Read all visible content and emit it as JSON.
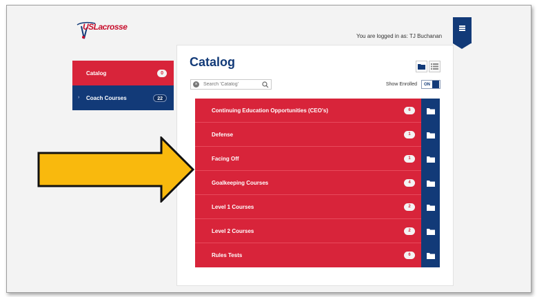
{
  "header": {
    "logo_text": "USLacrosse",
    "logged_in_text": "You are logged in as: TJ Buchanan"
  },
  "sidebar": {
    "items": [
      {
        "label": "Catalog",
        "count": "0"
      },
      {
        "label": "Coach Courses",
        "count": "22"
      }
    ]
  },
  "catalog": {
    "title": "Catalog",
    "search_placeholder": "Search 'Catalog'",
    "show_enrolled_label": "Show Enrolled",
    "toggle_label": "ON",
    "rows": [
      {
        "label": "Continuing Education Opportunities (CEO's)",
        "count": "6"
      },
      {
        "label": "Defense",
        "count": "1"
      },
      {
        "label": "Facing Off",
        "count": "1"
      },
      {
        "label": "Goalkeeping Courses",
        "count": "4"
      },
      {
        "label": "Level 1 Courses",
        "count": "2"
      },
      {
        "label": "Level 2 Courses",
        "count": "2"
      },
      {
        "label": "Rules Tests",
        "count": "6"
      }
    ]
  },
  "colors": {
    "brand_red": "#d8243a",
    "brand_blue": "#123a78",
    "arrow_yellow": "#f9b90d"
  },
  "icons": [
    "menu-icon",
    "folder-view-icon",
    "list-view-icon",
    "clear-search-icon",
    "search-icon",
    "folder-icon",
    "arrow-right-icon"
  ]
}
